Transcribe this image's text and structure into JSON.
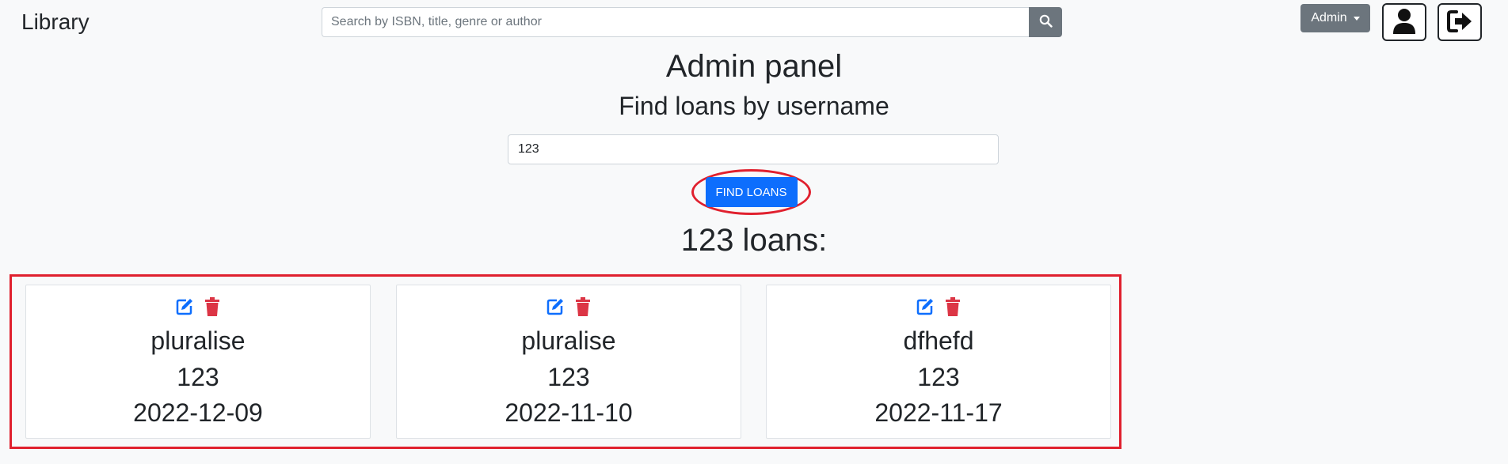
{
  "navbar": {
    "brand": "Library",
    "search_placeholder": "Search by ISBN, title, genre or author",
    "search_icon": "search-icon",
    "admin_label": "Admin",
    "profile_icon": "user-icon",
    "logout_icon": "sign-out-icon"
  },
  "main": {
    "title": "Admin panel",
    "subtitle": "Find loans by username",
    "username_value": "123",
    "find_button": "FIND LOANS",
    "result_heading": "123 loans:"
  },
  "loans": [
    {
      "title": "pluralise",
      "username": "123",
      "date": "2022-12-09"
    },
    {
      "title": "pluralise",
      "username": "123",
      "date": "2022-11-10"
    },
    {
      "title": "dfhefd",
      "username": "123",
      "date": "2022-11-17"
    }
  ],
  "colors": {
    "primary": "#0d6efd",
    "danger": "#dc3545",
    "secondary": "#6c757d",
    "highlight": "#e0202e"
  }
}
